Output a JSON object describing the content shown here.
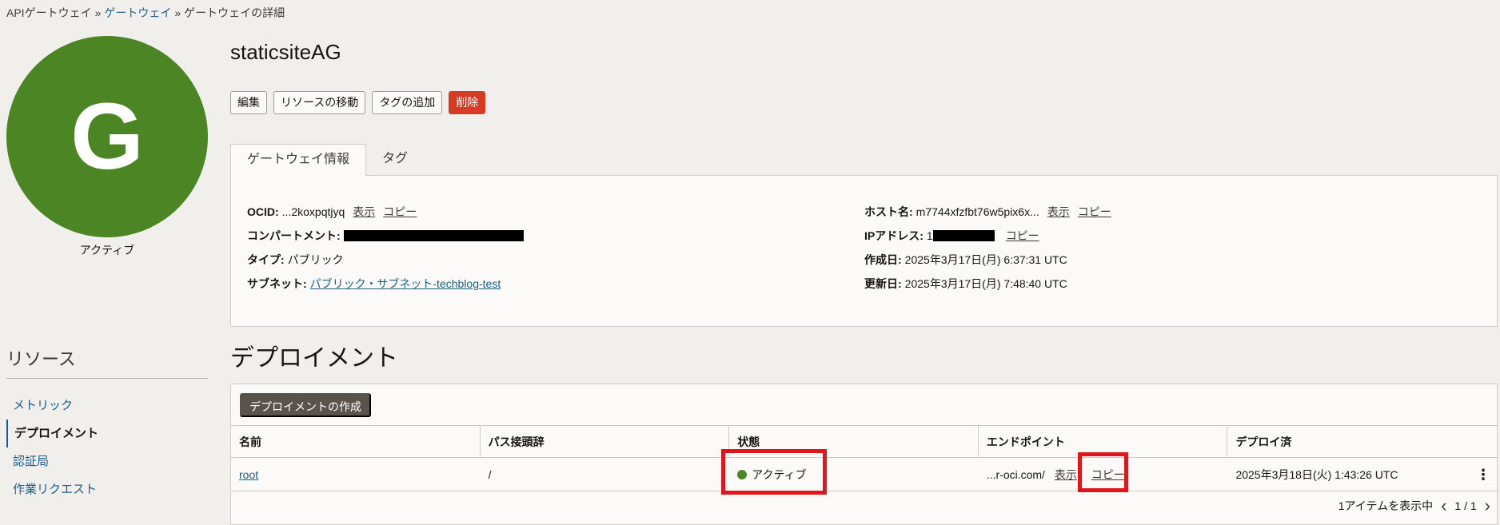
{
  "breadcrumb": {
    "root": "APIゲートウェイ",
    "parent": "ゲートウェイ",
    "current": "ゲートウェイの詳細",
    "sep": "»"
  },
  "avatar": {
    "letter": "G",
    "status": "アクティブ"
  },
  "resources": {
    "title": "リソース",
    "items": [
      {
        "label": "メトリック",
        "active": false
      },
      {
        "label": "デプロイメント",
        "active": true
      },
      {
        "label": "認証局",
        "active": false
      },
      {
        "label": "作業リクエスト",
        "active": false
      }
    ]
  },
  "gateway": {
    "name": "staticsiteAG"
  },
  "actions": {
    "edit": "編集",
    "move": "リソースの移動",
    "add_tags": "タグの追加",
    "delete": "削除"
  },
  "tabs": {
    "info": "ゲートウェイ情報",
    "tags": "タグ"
  },
  "info": {
    "ocid_label": "OCID:",
    "ocid_value": "...2koxpqtjyq",
    "show": "表示",
    "copy": "コピー",
    "compartment_label": "コンパートメント:",
    "type_label": "タイプ:",
    "type_value": "パブリック",
    "subnet_label": "サブネット:",
    "subnet_value": "パブリック・サブネット-techblog-test",
    "host_label": "ホスト名:",
    "host_value": "m7744xfzfbt76w5pix6x...",
    "ip_label": "IPアドレス:",
    "ip_prefix": "1",
    "created_label": "作成日:",
    "created_value": "2025年3月17日(月) 6:37:31 UTC",
    "updated_label": "更新日:",
    "updated_value": "2025年3月17日(月) 7:48:40 UTC"
  },
  "deployments": {
    "title": "デプロイメント",
    "create_button": "デプロイメントの作成",
    "columns": [
      "名前",
      "パス接頭辞",
      "状態",
      "エンドポイント",
      "デプロイ済"
    ],
    "rows": [
      {
        "name": "root",
        "path_prefix": "/",
        "state": "アクティブ",
        "endpoint": "...r-oci.com/",
        "show": "表示",
        "copy": "コピー",
        "deployed": "2025年3月18日(火) 1:43:26 UTC"
      }
    ],
    "footer": "1アイテムを表示中",
    "page": "1 / 1"
  },
  "colors": {
    "accent": "#4c8523",
    "danger": "#d63b25",
    "highlight": "#e0161c",
    "link": "#1b5d86"
  }
}
